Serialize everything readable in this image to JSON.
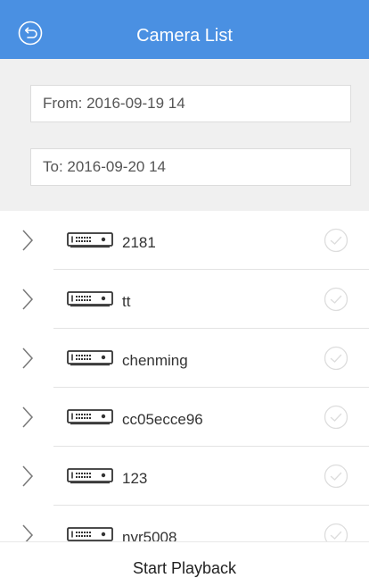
{
  "header": {
    "title": "Camera List",
    "back_icon": "back-arrow-circle-icon"
  },
  "filters": {
    "from": "From:  2016-09-19 14",
    "to": "To:  2016-09-20 14"
  },
  "devices": [
    {
      "name": "2181"
    },
    {
      "name": "tt"
    },
    {
      "name": "chenming"
    },
    {
      "name": "cc05ecce96"
    },
    {
      "name": "123"
    },
    {
      "name": "nvr5008"
    }
  ],
  "footer": {
    "start_label": "Start Playback"
  },
  "colors": {
    "header_bg": "#4a90e2",
    "filter_bg": "#f0f0f0"
  }
}
